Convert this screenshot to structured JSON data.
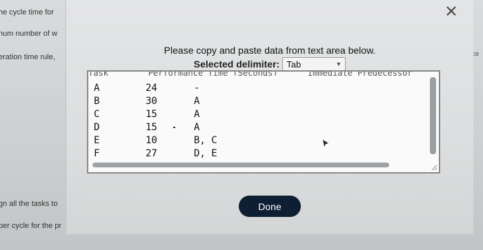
{
  "background": {
    "left_lines": [
      "he cycle time for",
      "num number of w",
      "eration time rule,",
      "gn all the tasks to",
      "per cycle for the pr"
    ],
    "right_text": "fence"
  },
  "dialog": {
    "instruction": "Please copy and paste data from text area below.",
    "delimiter_label": "Selected delimiter:",
    "delimiter_value": "Tab",
    "close_icon": "close-icon",
    "partial_header": "Task        Performance Time (Seconds)      Immediate Predecessor",
    "rows": [
      {
        "task": "A",
        "time": "24",
        "pred": "-"
      },
      {
        "task": "B",
        "time": "30",
        "pred": "A"
      },
      {
        "task": "C",
        "time": "15",
        "pred": "A"
      },
      {
        "task": "D",
        "time": "15",
        "pred": "A"
      },
      {
        "task": "E",
        "time": "10",
        "pred": "B, C"
      },
      {
        "task": "F",
        "time": "27",
        "pred": "D, E"
      }
    ],
    "done_label": "Done"
  },
  "colors": {
    "done_button": "#0f1f33",
    "dialog_bg": "#e0e1e2"
  }
}
